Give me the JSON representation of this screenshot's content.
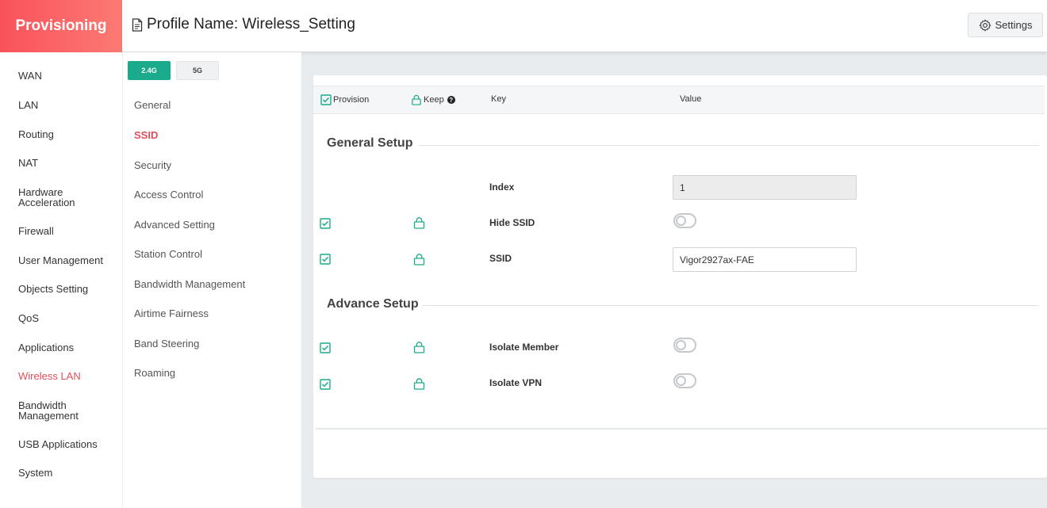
{
  "header": {
    "brand": "Provisioning",
    "page_title": "Profile Name: Wireless_Setting",
    "settings_label": "Settings"
  },
  "left_nav": {
    "items": [
      {
        "label": "WAN"
      },
      {
        "label": "LAN"
      },
      {
        "label": "Routing"
      },
      {
        "label": "NAT"
      },
      {
        "label": "Hardware",
        "label2": "Acceleration"
      },
      {
        "label": "Firewall"
      },
      {
        "label": "User Management"
      },
      {
        "label": "Objects Setting"
      },
      {
        "label": "QoS"
      },
      {
        "label": "Applications"
      },
      {
        "label": "Wireless LAN",
        "active": true
      },
      {
        "label": "Bandwidth",
        "label2": "Management"
      },
      {
        "label": "USB Applications"
      },
      {
        "label": "System"
      }
    ]
  },
  "sub_nav": {
    "tabs": [
      {
        "label": "2.4G",
        "active": true
      },
      {
        "label": "5G",
        "active": false
      }
    ],
    "items": [
      {
        "label": "General"
      },
      {
        "label": "SSID",
        "active": true
      },
      {
        "label": "Security"
      },
      {
        "label": "Access Control"
      },
      {
        "label": "Advanced Setting"
      },
      {
        "label": "Station Control"
      },
      {
        "label": "Bandwidth Management"
      },
      {
        "label": "Airtime Fairness"
      },
      {
        "label": "Band Steering"
      },
      {
        "label": "Roaming"
      }
    ]
  },
  "table": {
    "columns": {
      "provision": "Provision",
      "keep": "Keep",
      "key": "Key",
      "value": "Value"
    },
    "sections": [
      {
        "title": "General Setup",
        "rows": [
          {
            "key": "Index",
            "provision": false,
            "keep": false,
            "value_type": "input-disabled",
            "value": "1"
          },
          {
            "key": "Hide SSID",
            "provision": true,
            "keep": true,
            "value_type": "toggle",
            "value": false
          },
          {
            "key": "SSID",
            "provision": true,
            "keep": true,
            "value_type": "input",
            "value": "Vigor2927ax-FAE"
          }
        ]
      },
      {
        "title": "Advance Setup",
        "rows": [
          {
            "key": "Isolate Member",
            "provision": true,
            "keep": true,
            "value_type": "toggle",
            "value": false
          },
          {
            "key": "Isolate VPN",
            "provision": true,
            "keep": true,
            "value_type": "toggle",
            "value": false
          }
        ]
      }
    ]
  },
  "colors": {
    "brand_gradient_start": "#f9525a",
    "brand_gradient_end": "#fb7a74",
    "accent_green": "#1aaa8c",
    "active_red": "#e0505a"
  }
}
